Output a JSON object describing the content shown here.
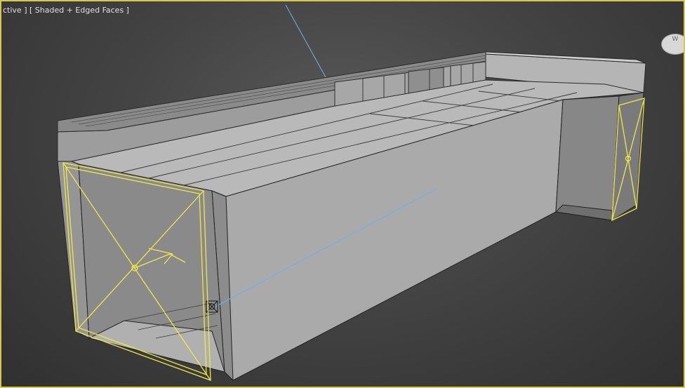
{
  "viewport": {
    "label_view": "ctive ]",
    "label_mode": "[ Shaded + Edged Faces ]",
    "border_color": "#d6c84a",
    "background": "#444444",
    "selection_color": "#f0e64a",
    "light_line_color": "#6fb3e6",
    "face_color": "#9a9a9a"
  },
  "viewcube": {
    "icon": "viewcube-icon",
    "letter": "W"
  }
}
